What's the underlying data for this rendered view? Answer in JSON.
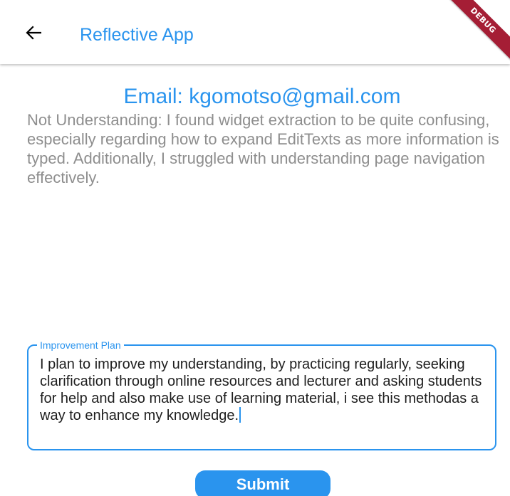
{
  "appbar": {
    "title": "Reflective App",
    "back_icon": "arrow-left-icon"
  },
  "debug_banner": "DEBUG",
  "colors": {
    "accent": "#2a94ee",
    "debug_ribbon": "#a51e35",
    "secondary_text": "#8e8e8e"
  },
  "main": {
    "email_heading": "Email: kgomotso@gmail.com",
    "not_understanding_text": "Not Understanding: I found widget extraction to be quite confusing, especially regarding how to expand EditTexts as more information is typed. Additionally, I struggled with understanding page navigation effectively."
  },
  "improvement_field": {
    "label": "Improvement Plan",
    "value": "I plan to improve my understanding, by practicing regularly, seeking clarification through online resources and lecturer and asking students for help and also make use of learning material, i see this methodas a way to enhance my knowledge."
  },
  "submit_label": "Submit"
}
